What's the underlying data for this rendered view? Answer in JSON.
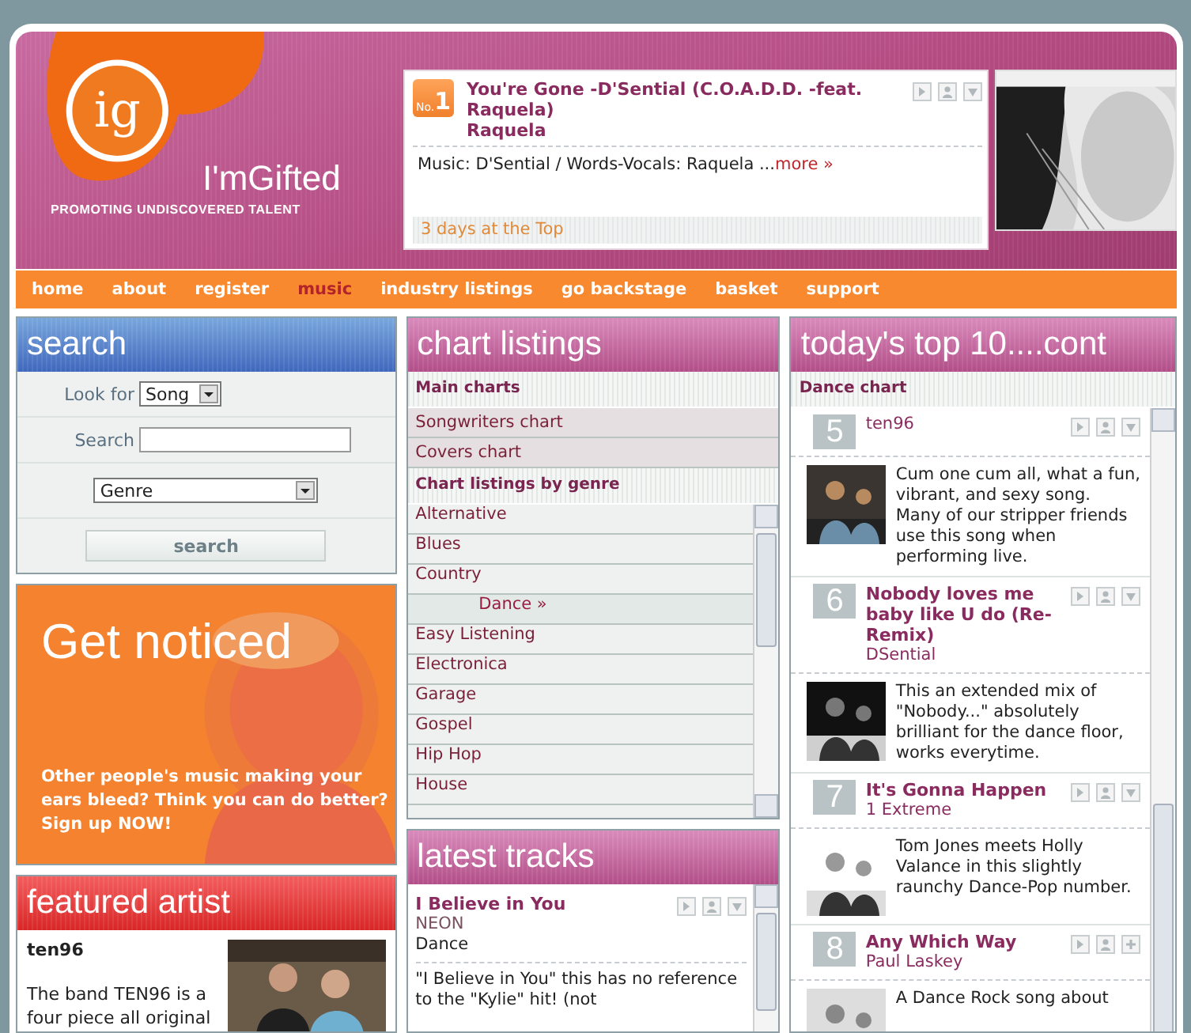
{
  "site": {
    "logo_mark": "ig",
    "name": "I'mGifted",
    "tagline": "PROMOTING UNDISCOVERED TALENT"
  },
  "featured_track": {
    "rank_prefix": "No.",
    "rank": "1",
    "title": "You're Gone -D'Sential (C.O.A.D.D. -feat. Raquela)",
    "artist": "Raquela",
    "description": "Music: D'Sential / Words-Vocals: Raquela ...",
    "more": "more »",
    "status": "3 days at the Top",
    "actions": [
      {
        "kind": "play"
      },
      {
        "kind": "person"
      },
      {
        "kind": "down"
      }
    ]
  },
  "nav": [
    {
      "label": "home",
      "selected": false
    },
    {
      "label": "about",
      "selected": false
    },
    {
      "label": "register",
      "selected": false
    },
    {
      "label": "music",
      "selected": true
    },
    {
      "label": "industry listings",
      "selected": false
    },
    {
      "label": "go backstage",
      "selected": false
    },
    {
      "label": "basket",
      "selected": false
    },
    {
      "label": "support",
      "selected": false
    }
  ],
  "search": {
    "title": "search",
    "look_for_label": "Look for",
    "look_for_value": "Song",
    "search_label": "Search",
    "genre_value": "Genre",
    "button": "search"
  },
  "promo": {
    "headline": "Get noticed",
    "text": "Other people's music making your ears bleed? Think you can do better? Sign up NOW!"
  },
  "featured_artist": {
    "title": "featured artist",
    "name": "ten96",
    "text": "The band TEN96 is a four piece all original"
  },
  "chart_listings": {
    "title": "chart listings",
    "sections": [
      {
        "heading": "Main charts",
        "kind": "main",
        "items": [
          {
            "label": "Songwriters chart",
            "selected": false
          },
          {
            "label": "Covers chart",
            "selected": false
          }
        ]
      },
      {
        "heading": "Chart listings by genre",
        "kind": "genre",
        "items": [
          {
            "label": "Alternative",
            "selected": false
          },
          {
            "label": "Blues",
            "selected": false
          },
          {
            "label": "Country",
            "selected": false
          },
          {
            "label": "Dance »",
            "selected": true
          },
          {
            "label": "Easy Listening",
            "selected": false
          },
          {
            "label": "Electronica",
            "selected": false
          },
          {
            "label": "Garage",
            "selected": false
          },
          {
            "label": "Gospel",
            "selected": false
          },
          {
            "label": "Hip Hop",
            "selected": false
          },
          {
            "label": "House",
            "selected": false
          }
        ]
      }
    ]
  },
  "latest_tracks": {
    "title": "latest tracks",
    "items": [
      {
        "title": "I Believe in You",
        "artist": "NEON",
        "genre": "Dance",
        "description": "\"I Believe in You\" this has no reference to the \"Kylie\" hit! (not",
        "actions": [
          {
            "kind": "play"
          },
          {
            "kind": "person"
          },
          {
            "kind": "down"
          }
        ]
      }
    ]
  },
  "top10": {
    "title": "today's top 10....cont",
    "subtitle": "Dance chart",
    "entries": [
      {
        "number": "5",
        "artist": "ten96",
        "blurb": "Cum one cum all, what a fun, vibrant, and sexy song. Many of our stripper friends use this song when performing live.",
        "actions": [
          {
            "kind": "play"
          },
          {
            "kind": "person"
          },
          {
            "kind": "down"
          }
        ]
      },
      {
        "number": "6",
        "title": "Nobody loves me baby like U do (Re-Remix)",
        "artist": "DSential",
        "blurb": "This an extended mix of \"Nobody...\" absolutely brilliant for the dance floor, works everytime.",
        "actions": [
          {
            "kind": "play"
          },
          {
            "kind": "person"
          },
          {
            "kind": "down"
          }
        ]
      },
      {
        "number": "7",
        "title": "It's Gonna Happen",
        "artist": "1 Extreme",
        "blurb": "Tom Jones meets Holly Valance in this slightly raunchy Dance-Pop number.",
        "actions": [
          {
            "kind": "play"
          },
          {
            "kind": "person"
          },
          {
            "kind": "down"
          }
        ]
      },
      {
        "number": "8",
        "title": "Any Which Way",
        "artist": "Paul Laskey",
        "blurb": "A Dance Rock song about",
        "actions": [
          {
            "kind": "play"
          },
          {
            "kind": "person"
          },
          {
            "kind": "add"
          }
        ]
      }
    ]
  }
}
